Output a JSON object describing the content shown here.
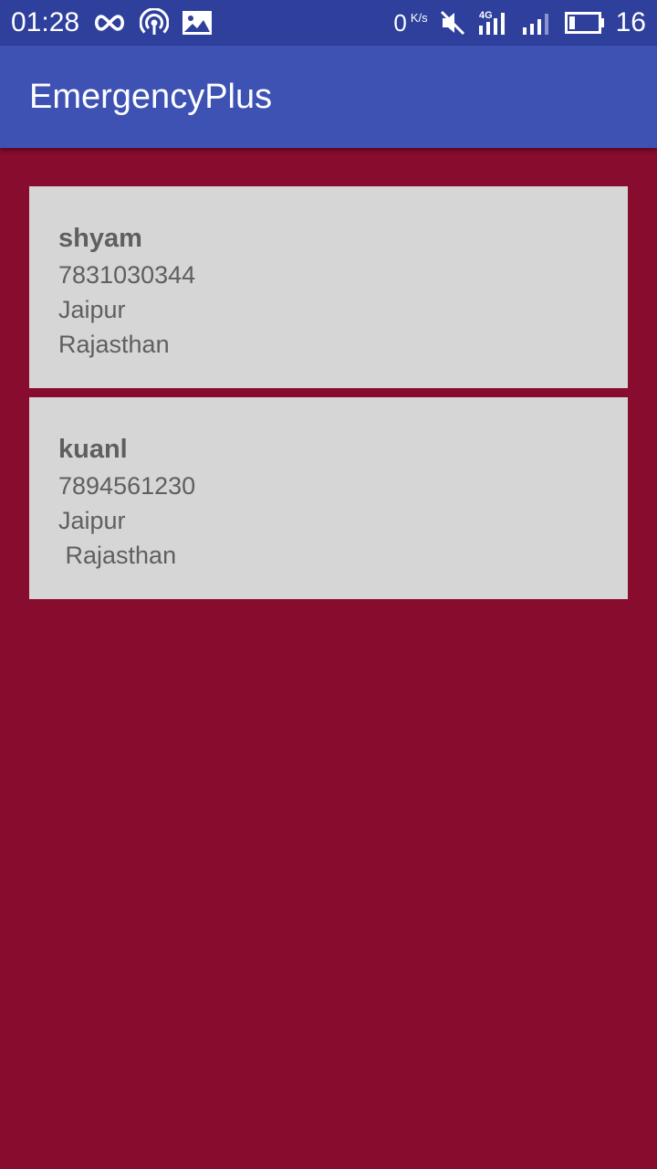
{
  "status_bar": {
    "time": "01:28",
    "net_speed_value": "0",
    "net_speed_unit": "K/s",
    "battery_percent": "16",
    "icons": [
      "infinity-icon",
      "hotspot-icon",
      "image-icon",
      "mute-icon",
      "4g-signal-icon",
      "signal-icon",
      "battery-icon"
    ]
  },
  "app_bar": {
    "title": "EmergencyPlus",
    "background": "#3d52b3"
  },
  "colors": {
    "page_background": "#880c2e",
    "status_bar": "#2e3f9c",
    "card_background": "#d6d6d6",
    "card_text": "#5f5f5f"
  },
  "contacts": [
    {
      "name": "shyam",
      "phone": "7831030344",
      "city": "Jaipur",
      "state": "Rajasthan"
    },
    {
      "name": "kuanl",
      "phone": "7894561230",
      "city": "Jaipur",
      "state": " Rajasthan"
    }
  ]
}
